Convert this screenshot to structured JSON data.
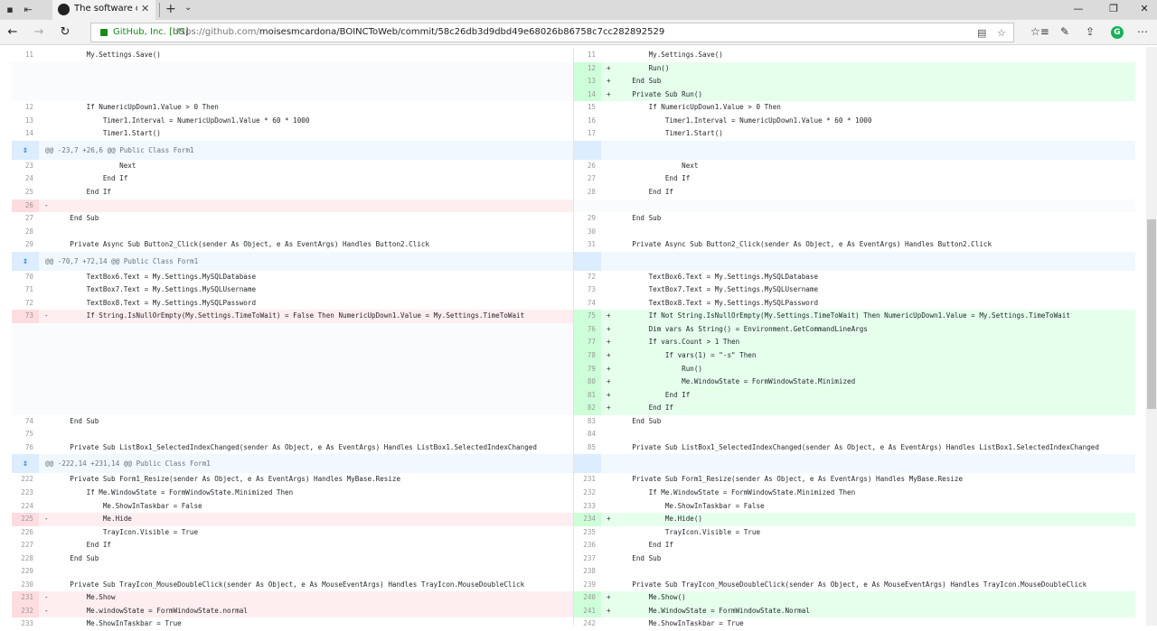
{
  "browser": {
    "tab_title": "The software can run si",
    "tab_close": "✕",
    "new_tab": "+",
    "tab_menu": "⌄",
    "cert": "GitHub, Inc. [US]",
    "url_prefix": "https://github.com/",
    "url_path": "moisesmcardona/BOINCToWeb/commit/58c26db3d9dbd49e68026b86758c7cc282892529",
    "window_controls": [
      "—",
      "❐",
      "✕"
    ],
    "nav_icons": [
      "←",
      "→",
      "↻"
    ],
    "toolbar_icons": [
      "☆≡",
      "✎",
      "⇪"
    ],
    "extension_letter": "G",
    "reading_icon": "▤",
    "favorite_icon": "☆"
  },
  "diff": {
    "left": [
      {
        "type": "ctx",
        "ln": "11",
        "mk": "",
        "text": "        My.Settings.Save()"
      },
      {
        "type": "empty",
        "ln": "",
        "mk": "",
        "text": ""
      },
      {
        "type": "empty",
        "ln": "",
        "mk": "",
        "text": ""
      },
      {
        "type": "empty",
        "ln": "",
        "mk": "",
        "text": ""
      },
      {
        "type": "ctx",
        "ln": "12",
        "mk": "",
        "text": "        If NumericUpDown1.Value > 0 Then"
      },
      {
        "type": "ctx",
        "ln": "13",
        "mk": "",
        "text": "            Timer1.Interval = NumericUpDown1.Value * 60 * 1000"
      },
      {
        "type": "ctx",
        "ln": "14",
        "mk": "",
        "text": "            Timer1.Start()"
      },
      {
        "type": "hunk",
        "ln": "",
        "mk": "",
        "text": "@@ -23,7 +26,6 @@ Public Class Form1"
      },
      {
        "type": "ctx",
        "ln": "23",
        "mk": "",
        "text": "                Next"
      },
      {
        "type": "ctx",
        "ln": "24",
        "mk": "",
        "text": "            End If"
      },
      {
        "type": "ctx",
        "ln": "25",
        "mk": "",
        "text": "        End If"
      },
      {
        "type": "del",
        "ln": "26",
        "mk": "-",
        "text": ""
      },
      {
        "type": "ctx",
        "ln": "27",
        "mk": "",
        "text": "    End Sub"
      },
      {
        "type": "ctx",
        "ln": "28",
        "mk": "",
        "text": ""
      },
      {
        "type": "ctx",
        "ln": "29",
        "mk": "",
        "text": "    Private Async Sub Button2_Click(sender As Object, e As EventArgs) Handles Button2.Click"
      },
      {
        "type": "hunk",
        "ln": "",
        "mk": "",
        "text": "@@ -70,7 +72,14 @@ Public Class Form1"
      },
      {
        "type": "ctx",
        "ln": "70",
        "mk": "",
        "text": "        TextBox6.Text = My.Settings.MySQLDatabase"
      },
      {
        "type": "ctx",
        "ln": "71",
        "mk": "",
        "text": "        TextBox7.Text = My.Settings.MySQLUsername"
      },
      {
        "type": "ctx",
        "ln": "72",
        "mk": "",
        "text": "        TextBox8.Text = My.Settings.MySQLPassword"
      },
      {
        "type": "del",
        "ln": "73",
        "mk": "-",
        "text": "        If String.IsNullOrEmpty(My.Settings.TimeToWait) = False Then NumericUpDown1.Value = My.Settings.TimeToWait"
      },
      {
        "type": "empty",
        "ln": "",
        "mk": "",
        "text": ""
      },
      {
        "type": "empty",
        "ln": "",
        "mk": "",
        "text": ""
      },
      {
        "type": "empty",
        "ln": "",
        "mk": "",
        "text": ""
      },
      {
        "type": "empty",
        "ln": "",
        "mk": "",
        "text": ""
      },
      {
        "type": "empty",
        "ln": "",
        "mk": "",
        "text": ""
      },
      {
        "type": "empty",
        "ln": "",
        "mk": "",
        "text": ""
      },
      {
        "type": "empty",
        "ln": "",
        "mk": "",
        "text": ""
      },
      {
        "type": "ctx",
        "ln": "74",
        "mk": "",
        "text": "    End Sub"
      },
      {
        "type": "ctx",
        "ln": "75",
        "mk": "",
        "text": ""
      },
      {
        "type": "ctx",
        "ln": "76",
        "mk": "",
        "text": "    Private Sub ListBox1_SelectedIndexChanged(sender As Object, e As EventArgs) Handles ListBox1.SelectedIndexChanged"
      },
      {
        "type": "hunk",
        "ln": "",
        "mk": "",
        "text": "@@ -222,14 +231,14 @@ Public Class Form1"
      },
      {
        "type": "ctx",
        "ln": "222",
        "mk": "",
        "text": "    Private Sub Form1_Resize(sender As Object, e As EventArgs) Handles MyBase.Resize"
      },
      {
        "type": "ctx",
        "ln": "223",
        "mk": "",
        "text": "        If Me.WindowState = FormWindowState.Minimized Then"
      },
      {
        "type": "ctx",
        "ln": "224",
        "mk": "",
        "text": "            Me.ShowInTaskbar = False"
      },
      {
        "type": "del",
        "ln": "225",
        "mk": "-",
        "text": "            Me.Hide"
      },
      {
        "type": "ctx",
        "ln": "226",
        "mk": "",
        "text": "            TrayIcon.Visible = True"
      },
      {
        "type": "ctx",
        "ln": "227",
        "mk": "",
        "text": "        End If"
      },
      {
        "type": "ctx",
        "ln": "228",
        "mk": "",
        "text": "    End Sub"
      },
      {
        "type": "ctx",
        "ln": "229",
        "mk": "",
        "text": ""
      },
      {
        "type": "ctx",
        "ln": "230",
        "mk": "",
        "text": "    Private Sub TrayIcon_MouseDoubleClick(sender As Object, e As MouseEventArgs) Handles TrayIcon.MouseDoubleClick"
      },
      {
        "type": "del",
        "ln": "231",
        "mk": "-",
        "text": "        Me.Show"
      },
      {
        "type": "del",
        "ln": "232",
        "mk": "-",
        "text": "        Me.windowState = FormWindowState.normal"
      },
      {
        "type": "ctx",
        "ln": "233",
        "mk": "",
        "text": "        Me.ShowInTaskbar = True"
      }
    ],
    "right": [
      {
        "type": "ctx",
        "ln": "11",
        "mk": "",
        "text": "        My.Settings.Save()"
      },
      {
        "type": "add",
        "ln": "12",
        "mk": "+",
        "text": "        Run()"
      },
      {
        "type": "add",
        "ln": "13",
        "mk": "+",
        "text": "    End Sub"
      },
      {
        "type": "add",
        "ln": "14",
        "mk": "+",
        "text": "    Private Sub Run()"
      },
      {
        "type": "ctx",
        "ln": "15",
        "mk": "",
        "text": "        If NumericUpDown1.Value > 0 Then"
      },
      {
        "type": "ctx",
        "ln": "16",
        "mk": "",
        "text": "            Timer1.Interval = NumericUpDown1.Value * 60 * 1000"
      },
      {
        "type": "ctx",
        "ln": "17",
        "mk": "",
        "text": "            Timer1.Start()"
      },
      {
        "type": "hunk",
        "ln": "",
        "mk": "",
        "text": ""
      },
      {
        "type": "ctx",
        "ln": "26",
        "mk": "",
        "text": "                Next"
      },
      {
        "type": "ctx",
        "ln": "27",
        "mk": "",
        "text": "            End If"
      },
      {
        "type": "ctx",
        "ln": "28",
        "mk": "",
        "text": "        End If"
      },
      {
        "type": "empty",
        "ln": "",
        "mk": "",
        "text": ""
      },
      {
        "type": "ctx",
        "ln": "29",
        "mk": "",
        "text": "    End Sub"
      },
      {
        "type": "ctx",
        "ln": "30",
        "mk": "",
        "text": ""
      },
      {
        "type": "ctx",
        "ln": "31",
        "mk": "",
        "text": "    Private Async Sub Button2_Click(sender As Object, e As EventArgs) Handles Button2.Click"
      },
      {
        "type": "hunk",
        "ln": "",
        "mk": "",
        "text": ""
      },
      {
        "type": "ctx",
        "ln": "72",
        "mk": "",
        "text": "        TextBox6.Text = My.Settings.MySQLDatabase"
      },
      {
        "type": "ctx",
        "ln": "73",
        "mk": "",
        "text": "        TextBox7.Text = My.Settings.MySQLUsername"
      },
      {
        "type": "ctx",
        "ln": "74",
        "mk": "",
        "text": "        TextBox8.Text = My.Settings.MySQLPassword"
      },
      {
        "type": "add",
        "ln": "75",
        "mk": "+",
        "text": "        If Not String.IsNullOrEmpty(My.Settings.TimeToWait) Then NumericUpDown1.Value = My.Settings.TimeToWait"
      },
      {
        "type": "add",
        "ln": "76",
        "mk": "+",
        "text": "        Dim vars As String() = Environment.GetCommandLineArgs"
      },
      {
        "type": "add",
        "ln": "77",
        "mk": "+",
        "text": "        If vars.Count > 1 Then"
      },
      {
        "type": "add",
        "ln": "78",
        "mk": "+",
        "text": "            If vars(1) = \"-s\" Then"
      },
      {
        "type": "add",
        "ln": "79",
        "mk": "+",
        "text": "                Run()"
      },
      {
        "type": "add",
        "ln": "80",
        "mk": "+",
        "text": "                Me.WindowState = FormWindowState.Minimized"
      },
      {
        "type": "add",
        "ln": "81",
        "mk": "+",
        "text": "            End If"
      },
      {
        "type": "add",
        "ln": "82",
        "mk": "+",
        "text": "        End If"
      },
      {
        "type": "ctx",
        "ln": "83",
        "mk": "",
        "text": "    End Sub"
      },
      {
        "type": "ctx",
        "ln": "84",
        "mk": "",
        "text": ""
      },
      {
        "type": "ctx",
        "ln": "85",
        "mk": "",
        "text": "    Private Sub ListBox1_SelectedIndexChanged(sender As Object, e As EventArgs) Handles ListBox1.SelectedIndexChanged"
      },
      {
        "type": "hunk",
        "ln": "",
        "mk": "",
        "text": ""
      },
      {
        "type": "ctx",
        "ln": "231",
        "mk": "",
        "text": "    Private Sub Form1_Resize(sender As Object, e As EventArgs) Handles MyBase.Resize"
      },
      {
        "type": "ctx",
        "ln": "232",
        "mk": "",
        "text": "        If Me.WindowState = FormWindowState.Minimized Then"
      },
      {
        "type": "ctx",
        "ln": "233",
        "mk": "",
        "text": "            Me.ShowInTaskbar = False"
      },
      {
        "type": "add",
        "ln": "234",
        "mk": "+",
        "text": "            Me.Hide()"
      },
      {
        "type": "ctx",
        "ln": "235",
        "mk": "",
        "text": "            TrayIcon.Visible = True"
      },
      {
        "type": "ctx",
        "ln": "236",
        "mk": "",
        "text": "        End If"
      },
      {
        "type": "ctx",
        "ln": "237",
        "mk": "",
        "text": "    End Sub"
      },
      {
        "type": "ctx",
        "ln": "238",
        "mk": "",
        "text": ""
      },
      {
        "type": "ctx",
        "ln": "239",
        "mk": "",
        "text": "    Private Sub TrayIcon_MouseDoubleClick(sender As Object, e As MouseEventArgs) Handles TrayIcon.MouseDoubleClick"
      },
      {
        "type": "add",
        "ln": "240",
        "mk": "+",
        "text": "        Me.Show()"
      },
      {
        "type": "add",
        "ln": "241",
        "mk": "+",
        "text": "        Me.WindowState = FormWindowState.Normal"
      },
      {
        "type": "ctx",
        "ln": "242",
        "mk": "",
        "text": "        Me.ShowInTaskbar = True"
      }
    ],
    "hunk_icon": "⇕",
    "colors": {
      "deleted": "#ffeef0",
      "added": "#e6ffed",
      "hunk": "#f1f8ff",
      "keyword": "#d73a49"
    }
  }
}
